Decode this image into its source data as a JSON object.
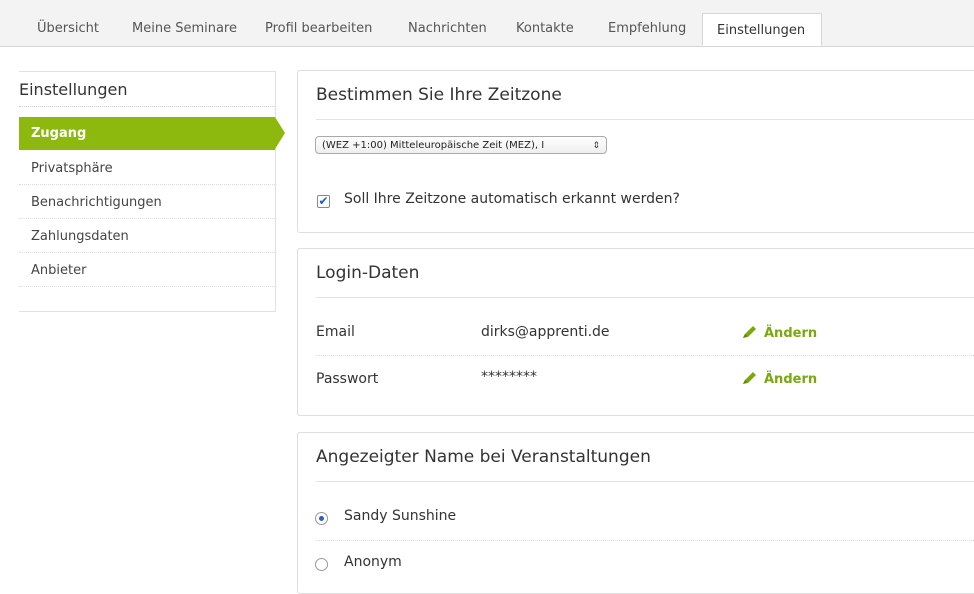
{
  "tabs": [
    {
      "label": "Übersicht"
    },
    {
      "label": "Meine Seminare"
    },
    {
      "label": "Profil bearbeiten"
    },
    {
      "label": "Nachrichten"
    },
    {
      "label": "Kontakte"
    },
    {
      "label": "Empfehlung"
    },
    {
      "label": "Einstellungen",
      "active": true
    }
  ],
  "sidebar": {
    "title": "Einstellungen",
    "items": [
      {
        "label": "Zugang",
        "active": true
      },
      {
        "label": "Privatsphäre"
      },
      {
        "label": "Benachrichtigungen"
      },
      {
        "label": "Zahlungsdaten"
      },
      {
        "label": "Anbieter"
      }
    ]
  },
  "timezone": {
    "title": "Bestimmen Sie Ihre Zeitzone",
    "selected": "(WEZ +1:00) Mitteleuropäische Zeit (MEZ), I",
    "auto_detect_label": "Soll Ihre Zeitzone automatisch erkannt werden?",
    "auto_detect_checked": true
  },
  "login": {
    "title": "Login-Daten",
    "rows": [
      {
        "label": "Email",
        "value": "dirks@apprenti.de",
        "action": "Ändern"
      },
      {
        "label": "Passwort",
        "value": "********",
        "action": "Ändern"
      }
    ]
  },
  "display_name": {
    "title": "Angezeigter Name bei Veranstaltungen",
    "options": [
      {
        "label": "Sandy Sunshine",
        "selected": true
      },
      {
        "label": "Anonym",
        "selected": false
      }
    ]
  },
  "colors": {
    "accent": "#8db90f",
    "link": "#7aa80d"
  }
}
